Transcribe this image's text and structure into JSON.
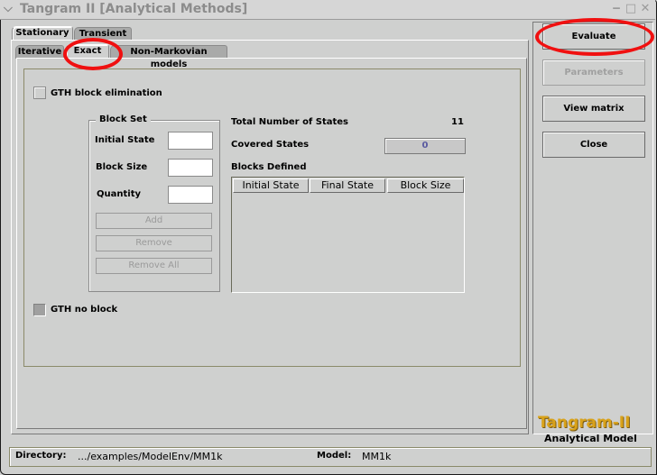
{
  "window": {
    "title": "Tangram II [Analytical Methods]",
    "controls": [
      "minimize",
      "maximize",
      "close"
    ]
  },
  "tabs": {
    "primary": [
      {
        "label": "Stationary",
        "active": true
      },
      {
        "label": "Transient",
        "active": false
      }
    ],
    "secondary": [
      {
        "label": "Iterative",
        "active": false
      },
      {
        "label": "Exact",
        "active": true
      },
      {
        "label": "Non-Markovian models",
        "active": false
      }
    ]
  },
  "exact": {
    "gth_block_label": "GTH block elimination",
    "gth_block_checked": false,
    "gth_noblock_label": "GTH no block",
    "gth_noblock_checked": false,
    "block_set": {
      "title": "Block Set",
      "initial_state_label": "Initial State",
      "initial_state_value": "",
      "block_size_label": "Block Size",
      "block_size_value": "",
      "quantity_label": "Quantity",
      "quantity_value": "",
      "add_label": "Add",
      "remove_label": "Remove",
      "remove_all_label": "Remove All"
    },
    "total_states_label": "Total Number of States",
    "total_states_value": "11",
    "covered_states_label": "Covered States",
    "covered_states_value": "0",
    "blocks_defined_label": "Blocks Defined",
    "table_columns": [
      "Initial State",
      "Final State",
      "Block Size"
    ],
    "table_rows": []
  },
  "side": {
    "evaluate_label": "Evaluate",
    "parameters_label": "Parameters",
    "view_matrix_label": "View matrix",
    "close_label": "Close",
    "logo_title": "Tangram-II",
    "logo_subtitle": "Analytical Model"
  },
  "status": {
    "directory_label": "Directory:",
    "directory_value": ".../examples/ModelEnv/MM1k",
    "model_label": "Model:",
    "model_value": "MM1k"
  },
  "colors": {
    "background": "#cfd0cf",
    "annotation": "#f01010",
    "logo_gold": "#d9a21a",
    "covered_value": "#5a5aa0"
  }
}
